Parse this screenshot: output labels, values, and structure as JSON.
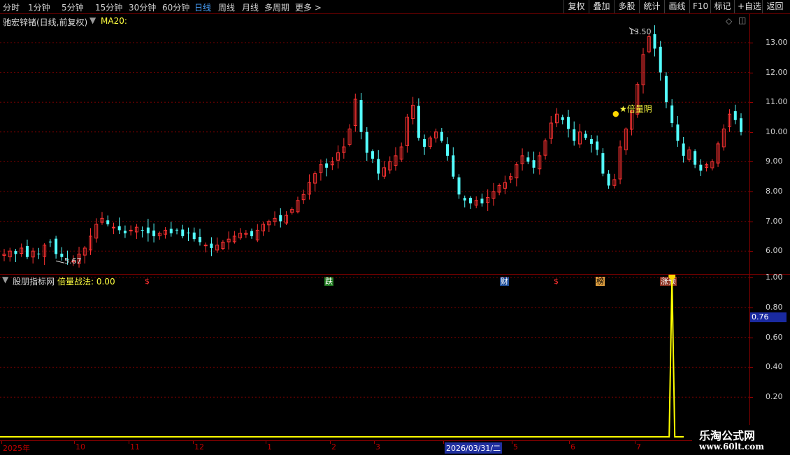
{
  "toolbar": {
    "timeframes": [
      "分时",
      "1分钟",
      "5分钟",
      "15分钟",
      "30分钟",
      "60分钟",
      "日线",
      "周线",
      "月线",
      "多周期",
      "更多 >"
    ],
    "active_timeframe": "日线",
    "buttons": [
      "复权",
      "叠加",
      "多股",
      "统计",
      "画线",
      "F10",
      "标记",
      "+自选",
      "返回"
    ]
  },
  "main_chart": {
    "title": "驰宏锌锗(日线,前复权)",
    "indicator": "MA20:",
    "high_label": "13.50",
    "low_label": "5.67",
    "signal_label": "★倍量阴",
    "events": [
      {
        "text": "$",
        "color": "#ff3030",
        "bg": "#000000"
      },
      {
        "text": "跌",
        "color": "#ffffff",
        "bg": "#1f7a1f"
      },
      {
        "text": "财",
        "color": "#ffffff",
        "bg": "#1f4f9a"
      },
      {
        "text": "$",
        "color": "#ff3030",
        "bg": "#000000"
      },
      {
        "text": "榜",
        "color": "#000000",
        "bg": "#e0a040"
      },
      {
        "text": "涨预",
        "color": "#ffffff",
        "bg": "#8a3020"
      }
    ]
  },
  "sub_chart": {
    "title": "股朋指标网",
    "indicator": "倍量战法: 0.00",
    "current_value_badge": "0.76"
  },
  "price_axis": [
    "13.00",
    "12.00",
    "11.00",
    "10.00",
    "9.00",
    "8.00",
    "7.00",
    "6.00"
  ],
  "sub_axis": [
    "1.00",
    "0.80",
    "0.60",
    "0.40",
    "0.20"
  ],
  "date_axis": [
    "2025年",
    "10",
    "11",
    "12",
    "1",
    "2",
    "3",
    "2026/03/31/二",
    "5",
    "6",
    "7"
  ],
  "watermark": {
    "name": "乐淘公式网",
    "url": "www.60lt.com"
  },
  "colors": {
    "up": "#ff3232",
    "down": "#54ffff",
    "grid": "#7a0000",
    "signal": "#ffff00",
    "accent": "#4aa3ff"
  },
  "chart_data": {
    "type": "candlestick",
    "ylim": [
      5.5,
      13.9
    ],
    "close": [
      5.9,
      6.0,
      5.9,
      6.1,
      5.8,
      6.0,
      5.9,
      6.2,
      6.3,
      5.9,
      5.8,
      5.7,
      5.67,
      5.9,
      6.1,
      6.5,
      6.9,
      7.1,
      6.9,
      6.8,
      6.7,
      6.6,
      6.7,
      6.8,
      6.7,
      6.6,
      6.5,
      6.6,
      6.7,
      6.6,
      6.7,
      6.5,
      6.6,
      6.4,
      6.3,
      6.2,
      6.1,
      6.2,
      6.3,
      6.4,
      6.5,
      6.6,
      6.6,
      6.5,
      6.7,
      6.9,
      7.0,
      7.1,
      7.0,
      7.2,
      7.4,
      7.7,
      7.9,
      8.3,
      8.6,
      8.9,
      8.8,
      9.0,
      9.3,
      9.5,
      10.1,
      11.1,
      10.0,
      9.3,
      9.1,
      8.6,
      8.8,
      9.0,
      9.2,
      9.5,
      10.5,
      10.9,
      9.8,
      9.5,
      9.8,
      10.0,
      9.7,
      9.2,
      8.5,
      7.9,
      7.7,
      7.6,
      7.7,
      7.6,
      7.8,
      8.0,
      8.2,
      8.3,
      8.5,
      8.9,
      9.2,
      9.0,
      8.8,
      9.2,
      9.7,
      10.3,
      10.6,
      10.4,
      10.1,
      9.7,
      10.0,
      9.8,
      9.6,
      9.4,
      8.6,
      8.2,
      8.4,
      9.5,
      10.1,
      10.7,
      11.6,
      12.6,
      13.2,
      12.8,
      12.0,
      11.0,
      10.3,
      9.7,
      9.2,
      9.4,
      8.9,
      8.7,
      8.9,
      9.0,
      9.6,
      10.1,
      10.6,
      10.4,
      10.0
    ],
    "annotations": [
      {
        "label": "13.50",
        "type": "high"
      },
      {
        "label": "5.67",
        "type": "low"
      }
    ]
  },
  "sub_chart_data": {
    "type": "line",
    "series": [
      {
        "name": "倍量战法",
        "values_note_index": 116,
        "peak": 1.0
      }
    ],
    "ylim": [
      0,
      1.1
    ]
  }
}
